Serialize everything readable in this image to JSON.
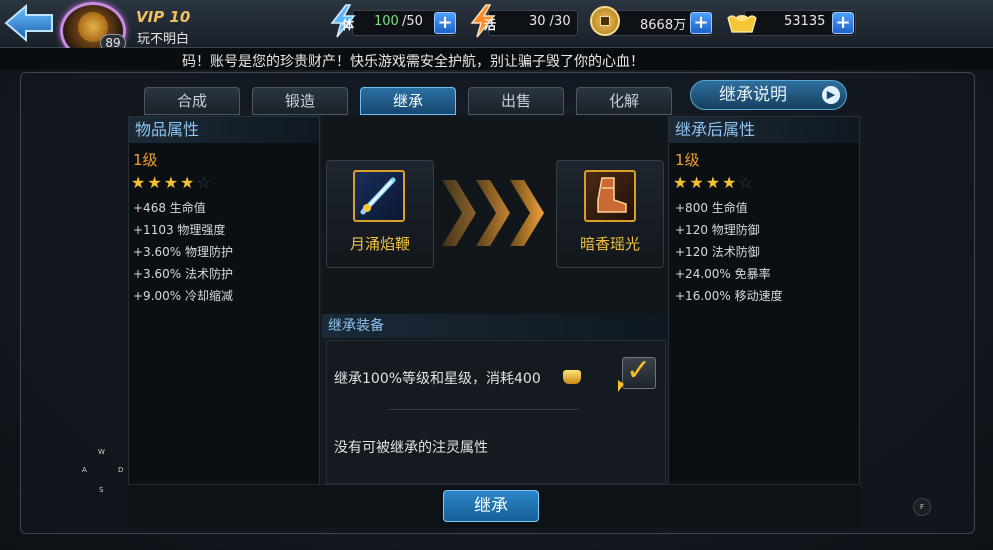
{
  "top_bar": {
    "vip": "VIP 10",
    "player_name": "玩不明白",
    "level": "89",
    "stamina": {
      "icon_char": "体",
      "current": "100",
      "max": "/50"
    },
    "vitality": {
      "icon_char": "活",
      "value": "30 /30"
    },
    "coins": "8668万",
    "ingots": "53135",
    "plus": "+"
  },
  "marquee": "码！账号是您的珍贵财产！快乐游戏需安全护航，别让骗子毁了你的心血！",
  "tabs": [
    "合成",
    "锻造",
    "继承",
    "出售",
    "化解"
  ],
  "active_tab": "继承",
  "help_button": "继承说明",
  "help_arrow": "▶",
  "left_panel": {
    "header": "物品属性",
    "level": "1级",
    "stars_filled": "★★★★",
    "stars_empty": "☆",
    "stats": [
      "+468 生命值",
      "+1103 物理强度",
      "+3.60% 物理防护",
      "+3.60% 法术防护",
      "+9.00% 冷却缩减"
    ]
  },
  "right_panel": {
    "header": "继承后属性",
    "level": "1级",
    "stars_filled": "★★★★",
    "stars_empty": "☆",
    "stats": [
      "+800 生命值",
      "+120 物理防御",
      "+120 法术防御",
      "+24.00% 免暴率",
      "+16.00% 移动速度"
    ]
  },
  "source_item": {
    "name": "月涌焰鞭",
    "icon": "whip-icon"
  },
  "target_item": {
    "name": "暗香瑶光",
    "icon": "boots-icon"
  },
  "inherit_section": {
    "header": "继承装备",
    "option_text": "继承100%等级和星级，消耗400",
    "option_checked": true,
    "checkmark": "✓",
    "no_spirit_text": "没有可被继承的注灵属性"
  },
  "inherit_button": "继承",
  "controls": {
    "up": "W",
    "left": "A",
    "right": "D",
    "down": "S",
    "f_key": "F"
  },
  "colors": {
    "accent_blue": "#2d86c8",
    "gold": "#f0c040",
    "orange_level": "#f0a030",
    "panel_header": "#8fc4ee"
  }
}
